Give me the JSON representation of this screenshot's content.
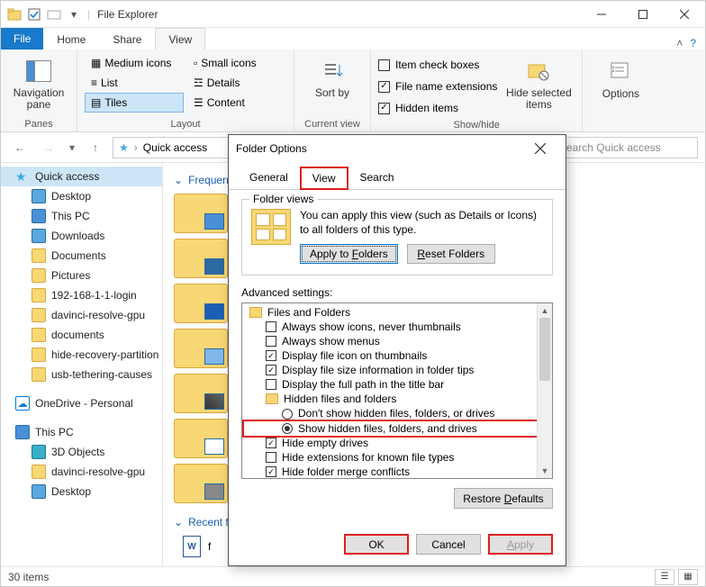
{
  "window": {
    "title": "File Explorer"
  },
  "ribbon": {
    "file": "File",
    "tabs": [
      "Home",
      "Share",
      "View"
    ],
    "active_tab": "View",
    "panes": {
      "nav_pane": "Navigation pane",
      "label": "Panes"
    },
    "layout": {
      "medium": "Medium icons",
      "small": "Small icons",
      "list": "List",
      "details": "Details",
      "tiles": "Tiles",
      "content": "Content",
      "label": "Layout"
    },
    "current": {
      "sort": "Sort by",
      "label": "Current view"
    },
    "showhide": {
      "item_check": "Item check boxes",
      "ext": "File name extensions",
      "hidden": "Hidden items",
      "hide_sel": "Hide selected items",
      "label": "Show/hide"
    },
    "options": "Options"
  },
  "address": {
    "location": "Quick access",
    "search_placeholder": "Search Quick access"
  },
  "tree": {
    "quick_access": "Quick access",
    "items1": [
      "Desktop",
      "This PC",
      "Downloads",
      "Documents",
      "Pictures",
      "192-168-1-1-login",
      "davinci-resolve-gpu",
      "documents",
      "hide-recovery-partition",
      "usb-tethering-causes"
    ],
    "onedrive": "OneDrive - Personal",
    "this_pc": "This PC",
    "items2": [
      "3D Objects",
      "davinci-resolve-gpu",
      "Desktop"
    ]
  },
  "content": {
    "frequent": "Frequent folders",
    "recent": "Recent files"
  },
  "status": {
    "count": "30 items"
  },
  "dialog": {
    "title": "Folder Options",
    "tabs": [
      "General",
      "View",
      "Search"
    ],
    "fv": {
      "legend": "Folder views",
      "desc": "You can apply this view (such as Details or Icons) to all folders of this type.",
      "apply": "Apply to Folders",
      "reset": "Reset Folders"
    },
    "adv_label": "Advanced settings:",
    "adv": {
      "root": "Files and Folders",
      "i0": "Always show icons, never thumbnails",
      "i1": "Always show menus",
      "i2": "Display file icon on thumbnails",
      "i3": "Display file size information in folder tips",
      "i4": "Display the full path in the title bar",
      "hidden_group": "Hidden files and folders",
      "r0": "Don't show hidden files, folders, or drives",
      "r1": "Show hidden files, folders, and drives",
      "i5": "Hide empty drives",
      "i6": "Hide extensions for known file types",
      "i7": "Hide folder merge conflicts"
    },
    "restore": "Restore Defaults",
    "ok": "OK",
    "cancel": "Cancel",
    "apply_btn": "Apply"
  }
}
